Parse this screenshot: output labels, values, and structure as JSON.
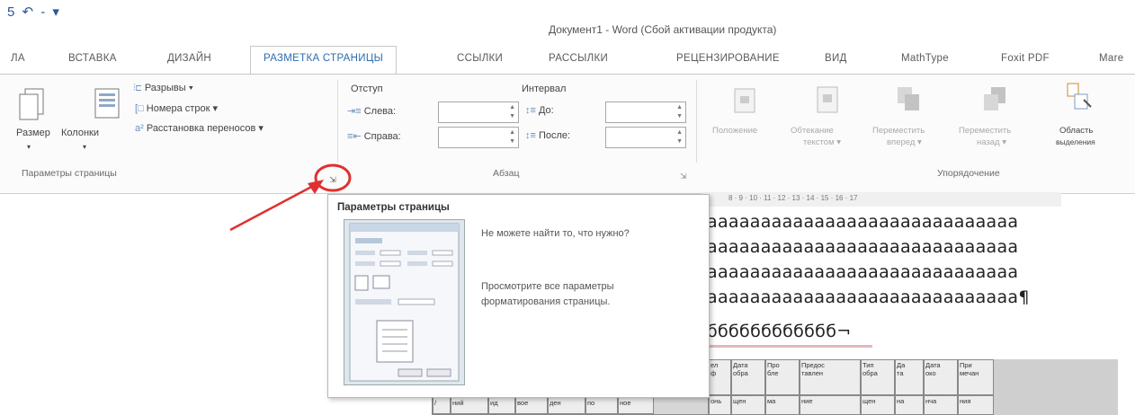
{
  "window": {
    "quick_access": "5 ↶ - ▾",
    "title": "Документ1 - Word (Сбой активации продукта)"
  },
  "tabs": [
    {
      "label": "ЛА",
      "active": false
    },
    {
      "label": "ВСТАВКА",
      "active": false
    },
    {
      "label": "ДИЗАЙН",
      "active": false
    },
    {
      "label": "РАЗМЕТКА СТРАНИЦЫ",
      "active": true
    },
    {
      "label": "ССЫЛКИ",
      "active": false
    },
    {
      "label": "РАССЫЛКИ",
      "active": false
    },
    {
      "label": "РЕЦЕНЗИРОВАНИЕ",
      "active": false
    },
    {
      "label": "ВИД",
      "active": false
    },
    {
      "label": "MathType",
      "active": false
    },
    {
      "label": "Foxit PDF",
      "active": false
    },
    {
      "label": "Mare",
      "active": false
    }
  ],
  "page_setup": {
    "size_label": "Размер",
    "columns_label": "Колонки",
    "breaks_label": "Разрывы ▾",
    "line_numbers_label": "Номера строк ▾",
    "hyphenation_label": "Расстановка переносов ▾",
    "group_label": "Параметры страницы"
  },
  "paragraph": {
    "indent_header": "Отступ",
    "left_label": "Слева:",
    "right_label": "Справа:",
    "spacing_header": "Интервал",
    "before_label": "До:",
    "after_label": "После:",
    "group_label": "Абзац"
  },
  "arrange": {
    "position_label": "Положение",
    "wrap_label": "Обтекание",
    "wrap_sub": "текстом ▾",
    "forward_label": "Переместить",
    "forward_sub": "вперед ▾",
    "backward_label": "Переместить",
    "backward_sub": "назад ▾",
    "selection_label": "Область",
    "selection_sub": "выделения",
    "group_label": "Упорядочение"
  },
  "tooltip": {
    "title": "Параметры страницы",
    "question": "Не можете найти то, что нужно?",
    "hint": "Просмотрите все параметры форматирования страницы."
  },
  "ruler": {
    "ticks": "8 · 9 · 10 · 11 · 12 · 13 · 14 · 15 · 16 · 17"
  },
  "document": {
    "lines": [
      "aaaaaaaaaaaaaaaaaaaaaaaaaaaaa",
      "aaaaaaaaaaaaaaaaaaaaaaaaaaaaa",
      "aaaaaaaaaaaaaaaaaaaaaaaaaaaaa",
      "aaaaaaaaaaaaaaaaaaaaaaaaaaaaa¶",
      "бббббббббббб¬"
    ],
    "table_headers": [
      "ел",
      "Дата",
      "Про",
      "Предос",
      "Тип",
      "Да",
      "Дата",
      "При"
    ],
    "table_header_sub": [
      "ф",
      "обра",
      "бле",
      "тавлен",
      "обра",
      "та",
      "око",
      "мечан"
    ],
    "table_row2": [
      "/",
      "ний",
      "ид",
      "вое",
      "ден",
      "по",
      "ное",
      "онь",
      "щен",
      "ма",
      "ние",
      "щен",
      "на",
      "нча",
      "ния"
    ]
  },
  "colors": {
    "accent": "#2b6cb0",
    "highlight": "#e03030"
  }
}
